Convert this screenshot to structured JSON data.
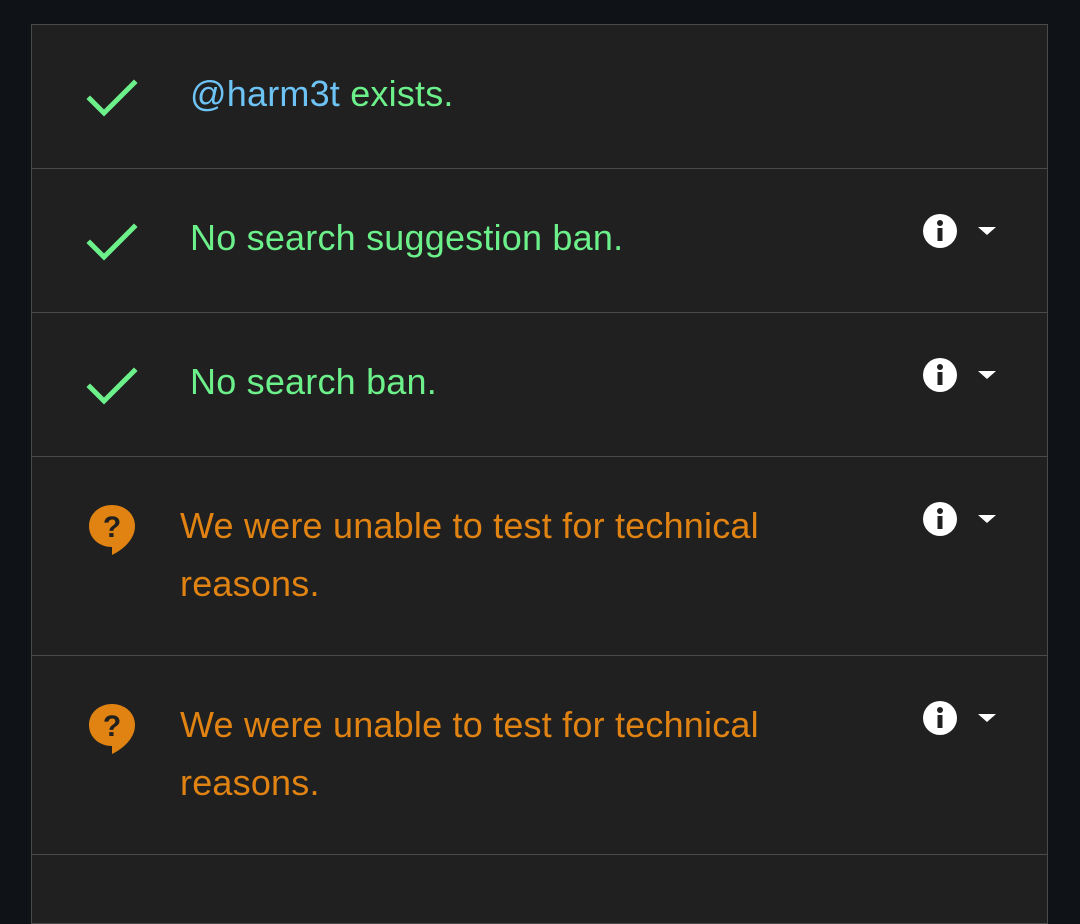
{
  "rows": [
    {
      "status": "ok",
      "icon": "check-icon",
      "username": "@harm3t",
      "text": " exists."
    },
    {
      "status": "ok",
      "icon": "check-icon",
      "text": "No search suggestion ban."
    },
    {
      "status": "ok",
      "icon": "check-icon",
      "text": "No search ban."
    },
    {
      "status": "unknown",
      "icon": "help-bubble-icon",
      "text": "We were unable to test for technical reasons."
    },
    {
      "status": "unknown",
      "icon": "help-bubble-icon",
      "text": "We were unable to test for technical reasons."
    }
  ],
  "colors": {
    "ok": "#6cf08a",
    "unknown": "#e08312",
    "username": "#6ec3f5",
    "panel_bg": "#202020",
    "page_bg": "#0f1317"
  },
  "action_icons": [
    "info-icon",
    "caret-down-icon"
  ]
}
